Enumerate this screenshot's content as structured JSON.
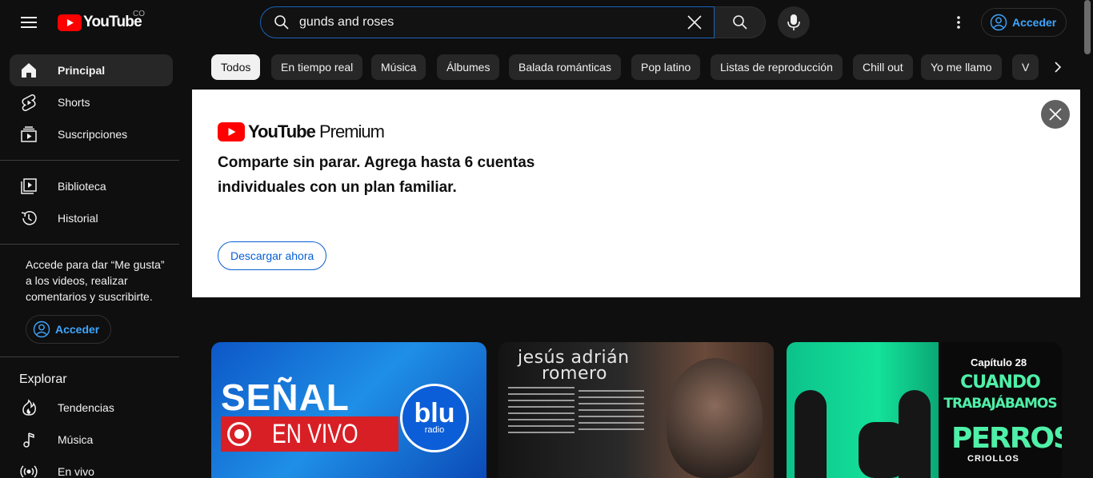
{
  "header": {
    "logo_text": "YouTube",
    "country_code": "CO",
    "search_value": "gunds and roses",
    "signin_label": "Acceder"
  },
  "sidebar": {
    "main_items": [
      {
        "label": "Principal",
        "icon": "home-icon",
        "active": true
      },
      {
        "label": "Shorts",
        "icon": "shorts-icon"
      },
      {
        "label": "Suscripciones",
        "icon": "subscriptions-icon"
      }
    ],
    "library_items": [
      {
        "label": "Biblioteca",
        "icon": "library-icon"
      },
      {
        "label": "Historial",
        "icon": "history-icon"
      }
    ],
    "signin_note": "Accede para dar “Me gusta” a los videos, realizar comentarios y suscribirte.",
    "signin_label": "Acceder",
    "explore_title": "Explorar",
    "explore_items": [
      {
        "label": "Tendencias",
        "icon": "trending-icon"
      },
      {
        "label": "Música",
        "icon": "music-icon"
      },
      {
        "label": "En vivo",
        "icon": "live-icon"
      }
    ]
  },
  "chips": [
    "Todos",
    "En tiempo real",
    "Música",
    "Álbumes",
    "Balada románticas",
    "Pop latino",
    "Listas de reproducción",
    "Chill out",
    "Yo me llamo",
    "V"
  ],
  "banner": {
    "brand_prefix": "YouTube",
    "brand_suffix": "Premium",
    "message": "Comparte sin parar. Agrega hasta 6 cuentas individuales con un plan familiar.",
    "cta_label": "Descargar ahora"
  },
  "thumbnails": {
    "t1": {
      "line1": "SEÑAL",
      "line2": "EN VIVO",
      "badge1": "blu",
      "badge2": "radio"
    },
    "t2": {
      "name_line1": "jesús adrián",
      "name_line2": "romero"
    },
    "t3": {
      "chapter": "Capítulo 28",
      "title1": "CUANDO",
      "title2": "TRABAJÁBAMOS",
      "show1": "PERROS",
      "show2": "CRIOLLOS"
    }
  },
  "colors": {
    "background": "#0f0f0f",
    "accent_blue": "#3ea6ff",
    "youtube_red": "#ff0000",
    "search_border": "#1c62b9"
  }
}
